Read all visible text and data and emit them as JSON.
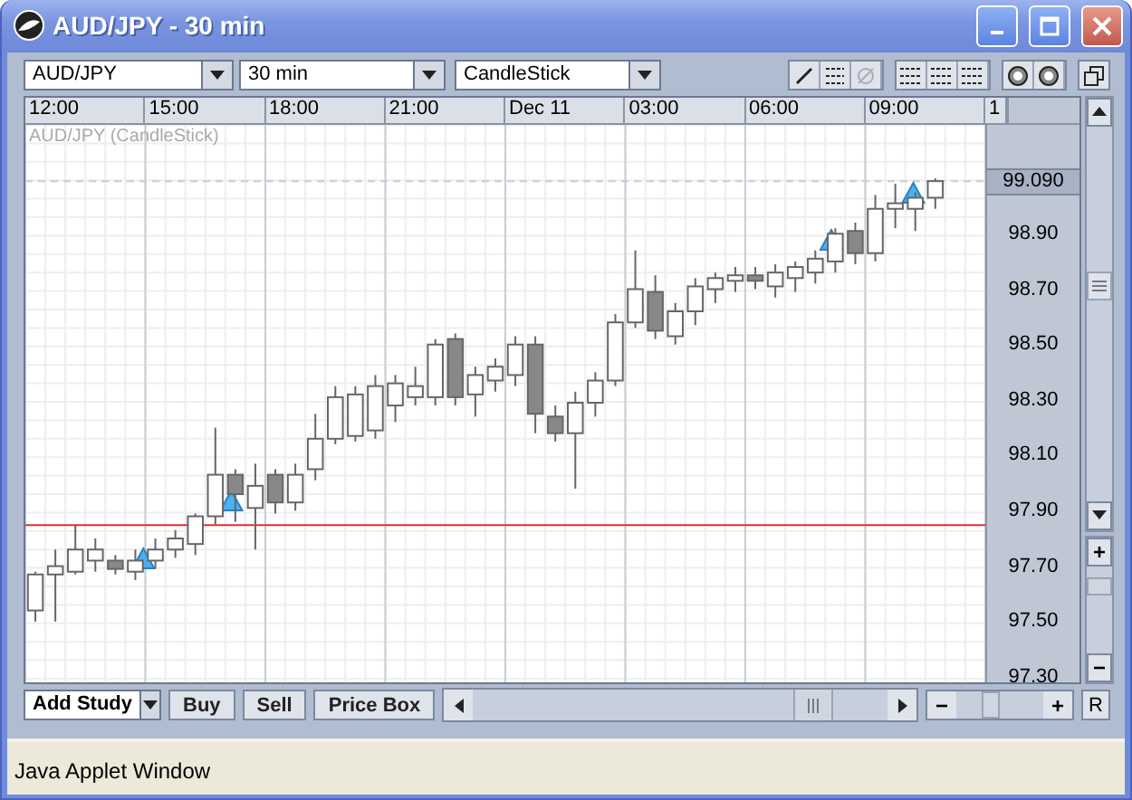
{
  "window": {
    "title": "AUD/JPY - 30 min"
  },
  "toolbar": {
    "symbol": "AUD/JPY",
    "interval": "30 min",
    "chart_type": "CandleStick",
    "tools": [
      {
        "kind": "line",
        "disabled": false
      },
      {
        "kind": "hlines",
        "disabled": false
      },
      {
        "kind": "no-sign",
        "disabled": true
      }
    ]
  },
  "chart": {
    "legend": "AUD/JPY (CandleStick)",
    "current_price": "99.090",
    "time_labels": [
      "12:00",
      "15:00",
      "18:00",
      "21:00",
      "Dec 11",
      "03:00",
      "06:00",
      "09:00",
      "1"
    ],
    "chart_data": {
      "type": "candlestick",
      "grid": true,
      "categories": [
        null,
        null,
        null,
        null,
        null,
        null,
        null,
        null,
        null,
        null,
        null,
        null,
        null,
        null,
        null,
        null,
        null,
        null,
        null,
        null,
        null,
        null,
        null,
        null,
        null,
        null,
        null,
        null,
        null,
        null,
        null,
        null,
        null,
        null,
        null,
        null,
        null,
        null,
        null,
        null,
        null,
        null,
        null,
        null,
        null,
        null,
        null,
        null
      ],
      "ohlc": [
        [
          97.54,
          97.68,
          97.5,
          97.67
        ],
        [
          97.67,
          97.76,
          97.5,
          97.7
        ],
        [
          97.68,
          97.85,
          97.67,
          97.76
        ],
        [
          97.72,
          97.8,
          97.68,
          97.76
        ],
        [
          97.72,
          97.74,
          97.67,
          97.69
        ],
        [
          97.68,
          97.76,
          97.65,
          97.72
        ],
        [
          97.72,
          97.8,
          97.69,
          97.76
        ],
        [
          97.76,
          97.83,
          97.73,
          97.8
        ],
        [
          97.78,
          97.89,
          97.74,
          97.88
        ],
        [
          97.88,
          98.2,
          97.85,
          98.03
        ],
        [
          98.03,
          98.05,
          97.86,
          97.96
        ],
        [
          97.91,
          98.07,
          97.76,
          97.99
        ],
        [
          98.03,
          98.05,
          97.89,
          97.93
        ],
        [
          97.93,
          98.07,
          97.9,
          98.03
        ],
        [
          98.05,
          98.25,
          98.01,
          98.16
        ],
        [
          98.16,
          98.35,
          98.14,
          98.31
        ],
        [
          98.17,
          98.35,
          98.15,
          98.32
        ],
        [
          98.19,
          98.39,
          98.16,
          98.35
        ],
        [
          98.28,
          98.39,
          98.22,
          98.36
        ],
        [
          98.31,
          98.42,
          98.28,
          98.35
        ],
        [
          98.31,
          98.52,
          98.28,
          98.5
        ],
        [
          98.52,
          98.54,
          98.28,
          98.31
        ],
        [
          98.32,
          98.42,
          98.24,
          98.39
        ],
        [
          98.37,
          98.45,
          98.33,
          98.42
        ],
        [
          98.39,
          98.53,
          98.35,
          98.5
        ],
        [
          98.5,
          98.53,
          98.18,
          98.25
        ],
        [
          98.24,
          98.28,
          98.15,
          98.18
        ],
        [
          98.18,
          98.33,
          97.98,
          98.29
        ],
        [
          98.29,
          98.4,
          98.24,
          98.37
        ],
        [
          98.37,
          98.61,
          98.35,
          98.58
        ],
        [
          98.58,
          98.84,
          98.56,
          98.7
        ],
        [
          98.69,
          98.75,
          98.52,
          98.55
        ],
        [
          98.53,
          98.65,
          98.5,
          98.62
        ],
        [
          98.62,
          98.74,
          98.57,
          98.71
        ],
        [
          98.7,
          98.76,
          98.65,
          98.74
        ],
        [
          98.73,
          98.78,
          98.69,
          98.75
        ],
        [
          98.75,
          98.78,
          98.7,
          98.73
        ],
        [
          98.71,
          98.79,
          98.67,
          98.76
        ],
        [
          98.74,
          98.8,
          98.69,
          98.78
        ],
        [
          98.76,
          98.84,
          98.72,
          98.81
        ],
        [
          98.8,
          98.92,
          98.76,
          98.9
        ],
        [
          98.91,
          98.94,
          98.79,
          98.83
        ],
        [
          98.83,
          99.04,
          98.8,
          98.99
        ],
        [
          98.99,
          99.08,
          98.92,
          99.01
        ],
        [
          98.99,
          99.05,
          98.91,
          99.03
        ],
        [
          99.03,
          99.1,
          98.99,
          99.09
        ],
        null,
        null
      ],
      "ylim": [
        97.274,
        99.293
      ],
      "yticks": [
        {
          "value": 98.9,
          "label": "98.90"
        },
        {
          "value": 98.7,
          "label": "98.70"
        },
        {
          "value": 98.5,
          "label": "98.50"
        },
        {
          "value": 98.3,
          "label": "98.30"
        },
        {
          "value": 98.1,
          "label": "98.10"
        },
        {
          "value": 97.9,
          "label": "97.90"
        },
        {
          "value": 97.7,
          "label": "97.70"
        },
        {
          "value": 97.5,
          "label": "97.50"
        },
        {
          "value": 97.3,
          "label": "97.30"
        }
      ],
      "ref_lines": [
        {
          "axis": "y",
          "value": 97.848,
          "color": "#e03030"
        },
        {
          "axis": "y",
          "value": 99.09
        }
      ]
    }
  },
  "vertical_zoom": {
    "zoom_in": "+",
    "zoom_out": "−"
  },
  "bottom_toolbar": {
    "study": "Add Study",
    "buttons": [
      "Buy",
      "Sell",
      "Price Box"
    ],
    "horizontal_zoom": {
      "zoom_out": "−",
      "zoom_in": "+"
    },
    "reset": "R"
  },
  "status_bar": "Java Applet Window"
}
